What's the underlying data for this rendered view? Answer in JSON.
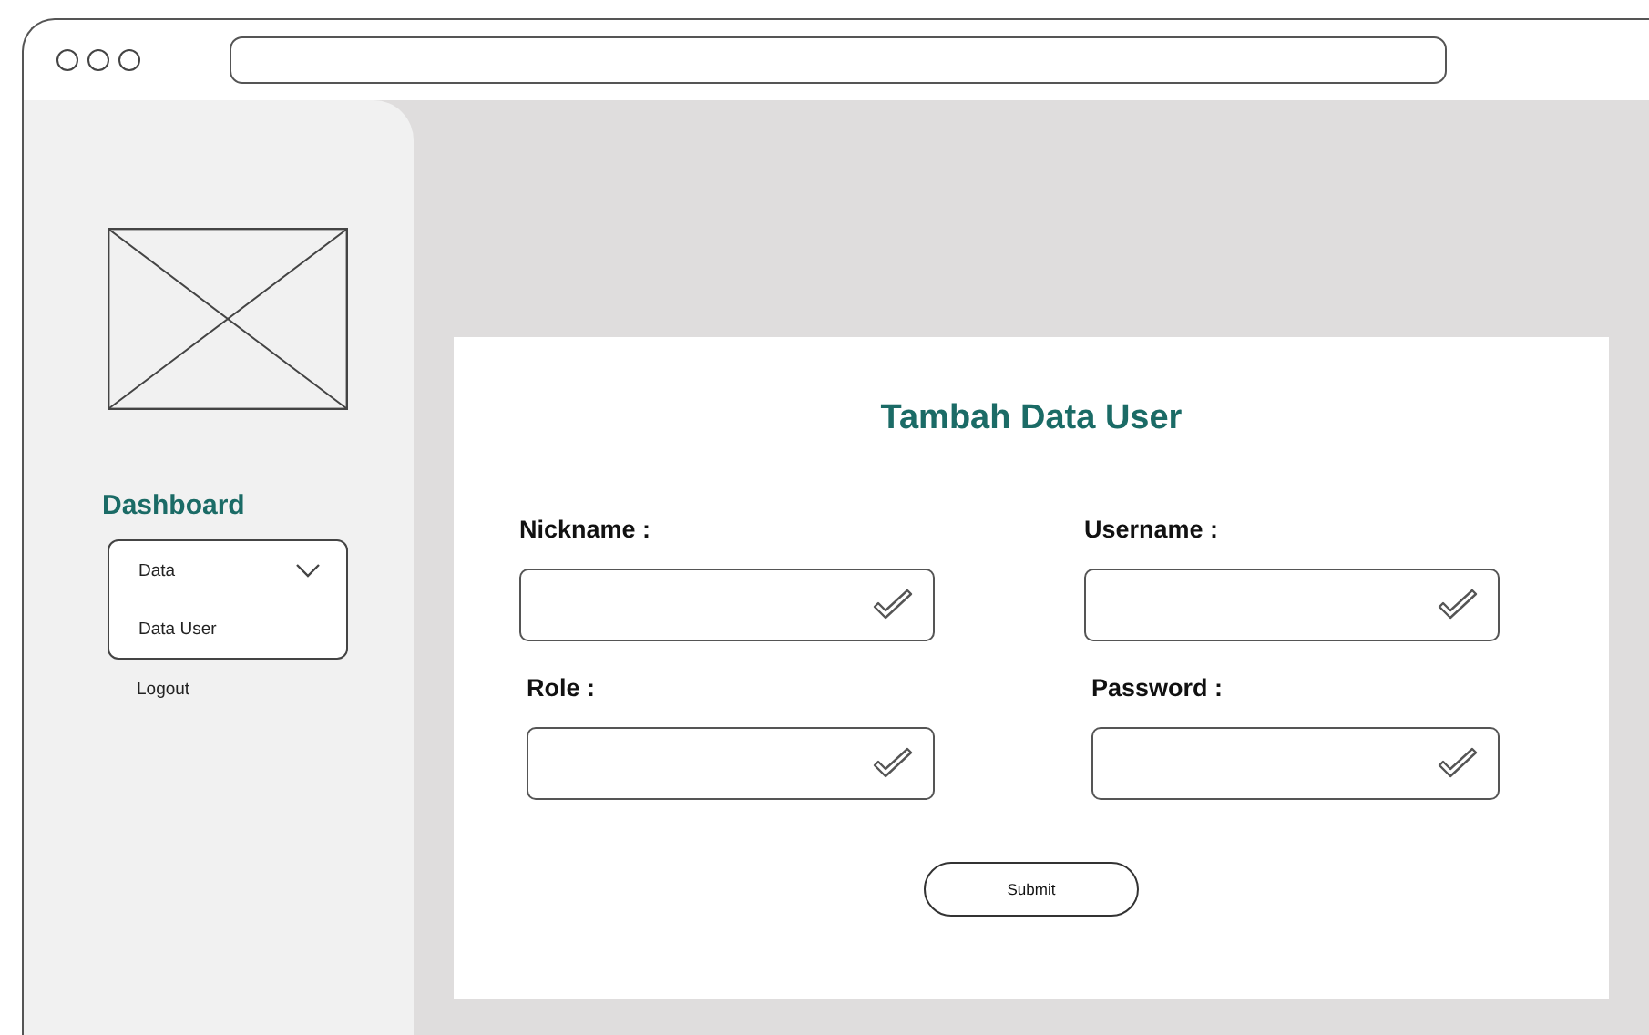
{
  "sidebar": {
    "title": "Dashboard",
    "menu": [
      {
        "label": "Data",
        "expanded": true,
        "children": [
          {
            "label": "Data User"
          }
        ]
      },
      {
        "label": "Logout"
      }
    ]
  },
  "form": {
    "title": "Tambah Data User",
    "fields": [
      {
        "label": "Nickname :"
      },
      {
        "label": "Username :"
      },
      {
        "label": "Role :"
      },
      {
        "label": "Password :"
      }
    ],
    "submit": "Submit"
  }
}
